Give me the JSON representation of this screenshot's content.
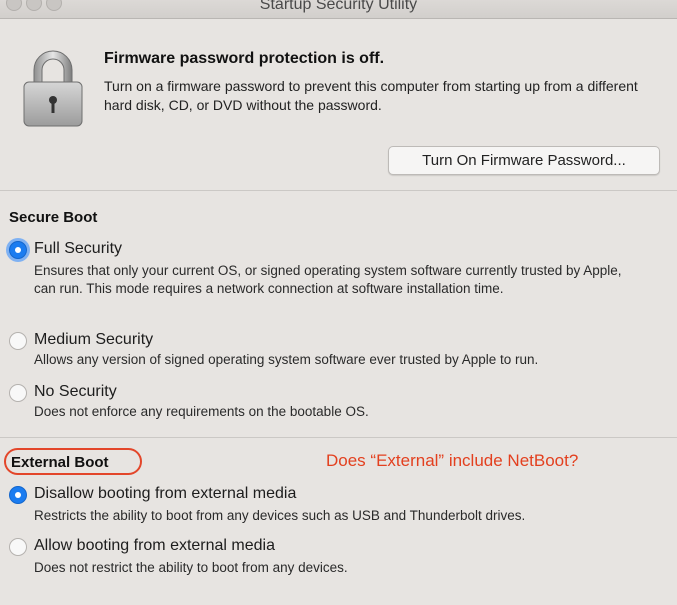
{
  "window": {
    "title": "Startup Security Utility"
  },
  "firmware": {
    "title": "Firmware password protection is off.",
    "description": "Turn on a firmware password to prevent this computer from starting up from a different hard disk, CD, or DVD without the password.",
    "button_label": "Turn On Firmware Password..."
  },
  "secure_boot": {
    "title": "Secure Boot",
    "options": [
      {
        "label": "Full Security",
        "selected": true,
        "description": "Ensures that only your current OS, or signed operating system software currently trusted by Apple, can run. This mode requires a network connection at software installation time."
      },
      {
        "label": "Medium Security",
        "selected": false,
        "description": "Allows any version of signed operating system software ever trusted by Apple to run."
      },
      {
        "label": "No Security",
        "selected": false,
        "description": "Does not enforce any requirements on the bootable OS."
      }
    ]
  },
  "external_boot": {
    "title": "External Boot",
    "annotation": "Does “External” include NetBoot?",
    "options": [
      {
        "label": "Disallow booting from external media",
        "selected": true,
        "description": "Restricts the ability to boot from any devices such as USB and Thunderbolt drives."
      },
      {
        "label": "Allow booting from external media",
        "selected": false,
        "description": "Does not restrict the ability to boot from any devices."
      }
    ]
  },
  "colors": {
    "accent": "#1b7cf0",
    "annotation": "#e3401f"
  },
  "icons": {
    "lock": "padlock-icon"
  }
}
